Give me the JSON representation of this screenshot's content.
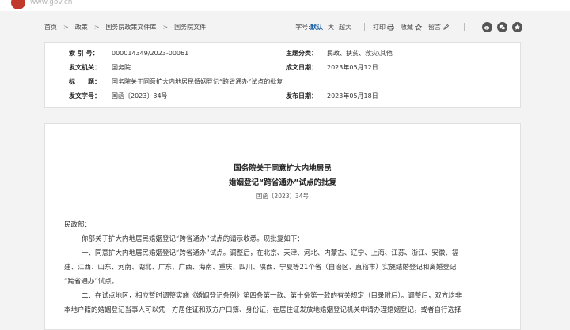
{
  "site": {
    "logo_text": "www.gov.cn"
  },
  "breadcrumb": [
    "首页",
    "政策",
    "国务院政策文件库",
    "国务院文件"
  ],
  "tools": {
    "font_label": "字号:",
    "font_default": "默认",
    "font_large": "大",
    "font_xlarge": "超大",
    "print": "打印",
    "bookmark": "收藏",
    "comment": "留言"
  },
  "meta": {
    "index_label": "索 引 号：",
    "index_value": "000014349/2023-00061",
    "topic_label": "主题分类：",
    "topic_value": "民政、扶贫、救灾\\其他",
    "issuer_label": "发文机关：",
    "issuer_value": "国务院",
    "created_label": "成文日期：",
    "created_value": "2023年05月12日",
    "title_label": "标　　题：",
    "title_value": "国务院关于同意扩大内地居民婚姻登记“跨省通办”试点的批复",
    "docno_label": "发文字号：",
    "docno_value": "国函〔2023〕34号",
    "published_label": "发布日期：",
    "published_value": "2023年05月18日"
  },
  "article": {
    "title_line1": "国务院关于同意扩大内地居民",
    "title_line2": "婚姻登记“跨省通办”试点的批复",
    "doc_number": "国函〔2023〕34号",
    "salutation": "民政部：",
    "p1": "你部关于扩大内地居民婚姻登记“跨省通办”试点的请示收悉。现批复如下：",
    "p2a": "一、同意扩大内地居民婚姻登记“跨省通办”试点。调整后，在北京、天津、河北、内蒙古、辽宁、上海、江苏、浙江、安徽、福",
    "p2b": "建、江西、山东、河南、湖北、广东、广西、海南、重庆、四川、陕西、宁夏等21个省（自治区、直辖市）实施结婚登记和离婚登记",
    "p2c": "“跨省通办”试点。",
    "p3a": "二、在试点地区，相应暂时调整实施《婚姻登记条例》第四条第一款、第十条第一款的有关规定（目录附后）。调整后，双方均非",
    "p3b": "本地户籍的婚姻登记当事人可以凭一方居住证和双方户口簿、身份证，在居住证发放地婚姻登记机关申请办理婚姻登记，或者自行选择"
  }
}
